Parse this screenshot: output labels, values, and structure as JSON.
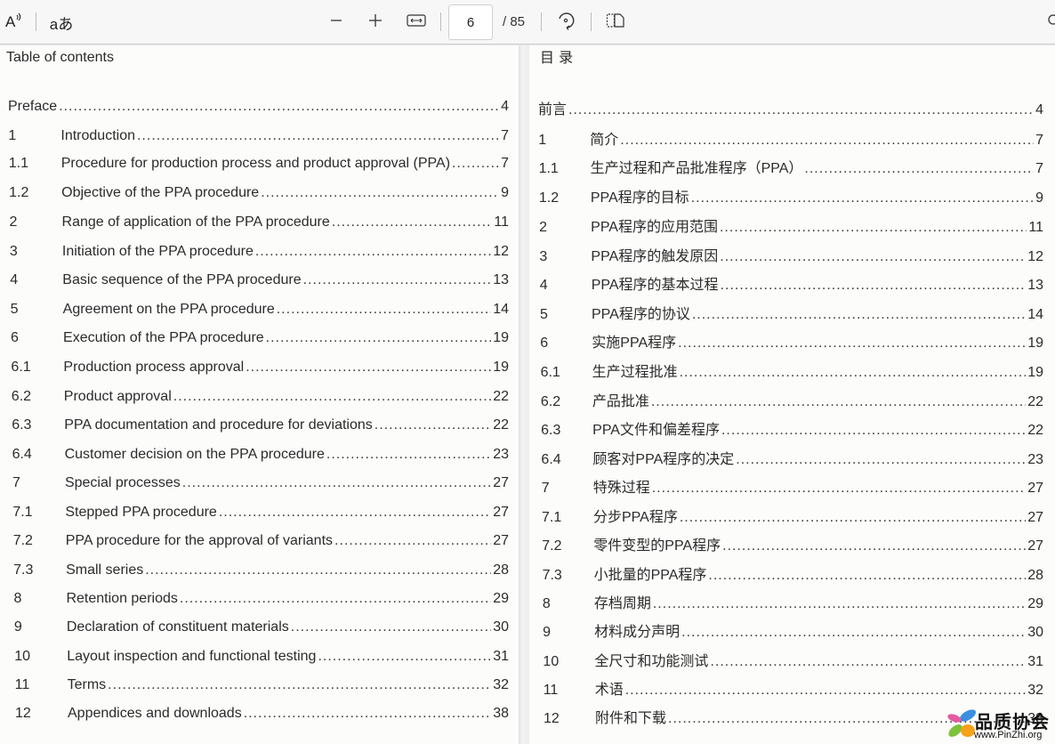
{
  "toolbar": {
    "read_aloud_icon": "A⁾",
    "text_options_icon": "aあ",
    "zoom_out_icon": "−",
    "zoom_in_icon": "+",
    "fit_width_icon": "fit-to-width",
    "current_page": "6",
    "total_pages": "/ 85",
    "rotate_icon": "rotate",
    "page_view_icon": "two-page-view"
  },
  "left_page": {
    "heading": "Table of contents",
    "entries": [
      {
        "num": "",
        "title": "Preface",
        "page": "4"
      },
      {
        "num": "1",
        "title": "Introduction",
        "page": "7"
      },
      {
        "num": "1.1",
        "title": "Procedure for production process and product approval (PPA)",
        "page": "7"
      },
      {
        "num": "1.2",
        "title": "Objective of the PPA procedure",
        "page": "9"
      },
      {
        "num": "2",
        "title": "Range of application of the PPA procedure",
        "page": "11"
      },
      {
        "num": "3",
        "title": "Initiation of the PPA procedure",
        "page": "12"
      },
      {
        "num": "4",
        "title": "Basic sequence of the PPA procedure",
        "page": "13"
      },
      {
        "num": "5",
        "title": "Agreement on the PPA procedure",
        "page": "14"
      },
      {
        "num": "6",
        "title": "Execution of the PPA procedure",
        "page": "19"
      },
      {
        "num": "6.1",
        "title": "Production process approval",
        "page": "19"
      },
      {
        "num": "6.2",
        "title": "Product approval",
        "page": "22"
      },
      {
        "num": "6.3",
        "title": "PPA documentation and procedure for deviations",
        "page": "22"
      },
      {
        "num": "6.4",
        "title": "Customer decision on the PPA procedure",
        "page": "23"
      },
      {
        "num": "7",
        "title": "Special processes",
        "page": "27"
      },
      {
        "num": "7.1",
        "title": "Stepped PPA procedure",
        "page": "27"
      },
      {
        "num": "7.2",
        "title": "PPA procedure for the approval of variants",
        "page": "27"
      },
      {
        "num": "7.3",
        "title": "Small series",
        "page": "28"
      },
      {
        "num": "8",
        "title": "Retention periods",
        "page": "29"
      },
      {
        "num": "9",
        "title": "Declaration of constituent materials",
        "page": "30"
      },
      {
        "num": "10",
        "title": "Layout inspection and functional testing",
        "page": "31"
      },
      {
        "num": "11",
        "title": "Terms",
        "page": "32"
      },
      {
        "num": "12",
        "title": "Appendices and downloads",
        "page": "38"
      }
    ]
  },
  "right_page": {
    "heading": "目 录",
    "entries": [
      {
        "num": "",
        "title": "前言",
        "page": "4"
      },
      {
        "num": "1",
        "title": "简介",
        "page": "7"
      },
      {
        "num": "1.1",
        "title": "生产过程和产品批准程序（PPA）",
        "page": "7"
      },
      {
        "num": "1.2",
        "title": "PPA程序的目标",
        "page": "9"
      },
      {
        "num": "2",
        "title": "PPA程序的应用范围",
        "page": "11"
      },
      {
        "num": "3",
        "title": "PPA程序的触发原因",
        "page": "12"
      },
      {
        "num": "4",
        "title": "PPA程序的基本过程",
        "page": "13"
      },
      {
        "num": "5",
        "title": "PPA程序的协议",
        "page": "14"
      },
      {
        "num": "6",
        "title": "实施PPA程序",
        "page": "19"
      },
      {
        "num": "6.1",
        "title": "生产过程批准",
        "page": "19"
      },
      {
        "num": "6.2",
        "title": "产品批准",
        "page": "22"
      },
      {
        "num": "6.3",
        "title": "PPA文件和偏差程序",
        "page": "22"
      },
      {
        "num": "6.4",
        "title": "顾客对PPA程序的决定",
        "page": "23"
      },
      {
        "num": "7",
        "title": "特殊过程",
        "page": "27"
      },
      {
        "num": "7.1",
        "title": "分步PPA程序",
        "page": "27"
      },
      {
        "num": "7.2",
        "title": "零件变型的PPA程序",
        "page": "27"
      },
      {
        "num": "7.3",
        "title": "小批量的PPA程序",
        "page": "28"
      },
      {
        "num": "8",
        "title": "存档周期",
        "page": "29"
      },
      {
        "num": "9",
        "title": "材料成分声明",
        "page": "30"
      },
      {
        "num": "10",
        "title": "全尺寸和功能测试",
        "page": "31"
      },
      {
        "num": "11",
        "title": "术语",
        "page": "32"
      },
      {
        "num": "12",
        "title": "附件和下载",
        "page": "38"
      }
    ]
  },
  "watermark": {
    "name": "品质协会",
    "url": "www.PinZhi.org"
  }
}
